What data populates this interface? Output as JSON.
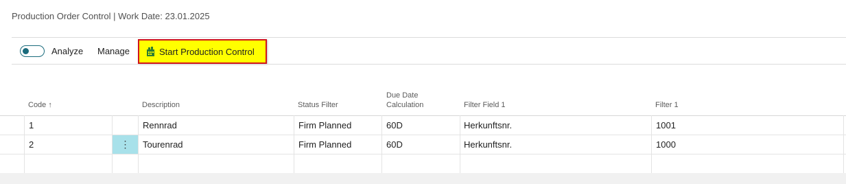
{
  "header": {
    "title": "Production Order Control | Work Date: 23.01.2025"
  },
  "actionbar": {
    "analyze_label": "Analyze",
    "manage_label": "Manage",
    "start_label": "Start Production Control",
    "highlight_color": "#ffff00",
    "highlight_border": "#d0141b",
    "toggle_color": "#1a6b7c"
  },
  "table": {
    "columns": {
      "code": "Code",
      "sort_indicator": "↑",
      "description": "Description",
      "status_filter": "Status Filter",
      "due_date_line1": "Due Date",
      "due_date_line2": "Calculation",
      "filter_field_1": "Filter Field 1",
      "filter_1": "Filter 1"
    },
    "rows": [
      {
        "code": "1",
        "description": "Rennrad",
        "status_filter": "Firm Planned",
        "due_date": "60D",
        "filter_field_1": "Herkunftsnr.",
        "filter_1": "1001"
      },
      {
        "code": "2",
        "description": "Tourenrad",
        "status_filter": "Firm Planned",
        "due_date": "60D",
        "filter_field_1": "Herkunftsnr.",
        "filter_1": "1000"
      }
    ],
    "row_menu_icon": "⋮",
    "selected_row_color": "#a8e1ea"
  }
}
